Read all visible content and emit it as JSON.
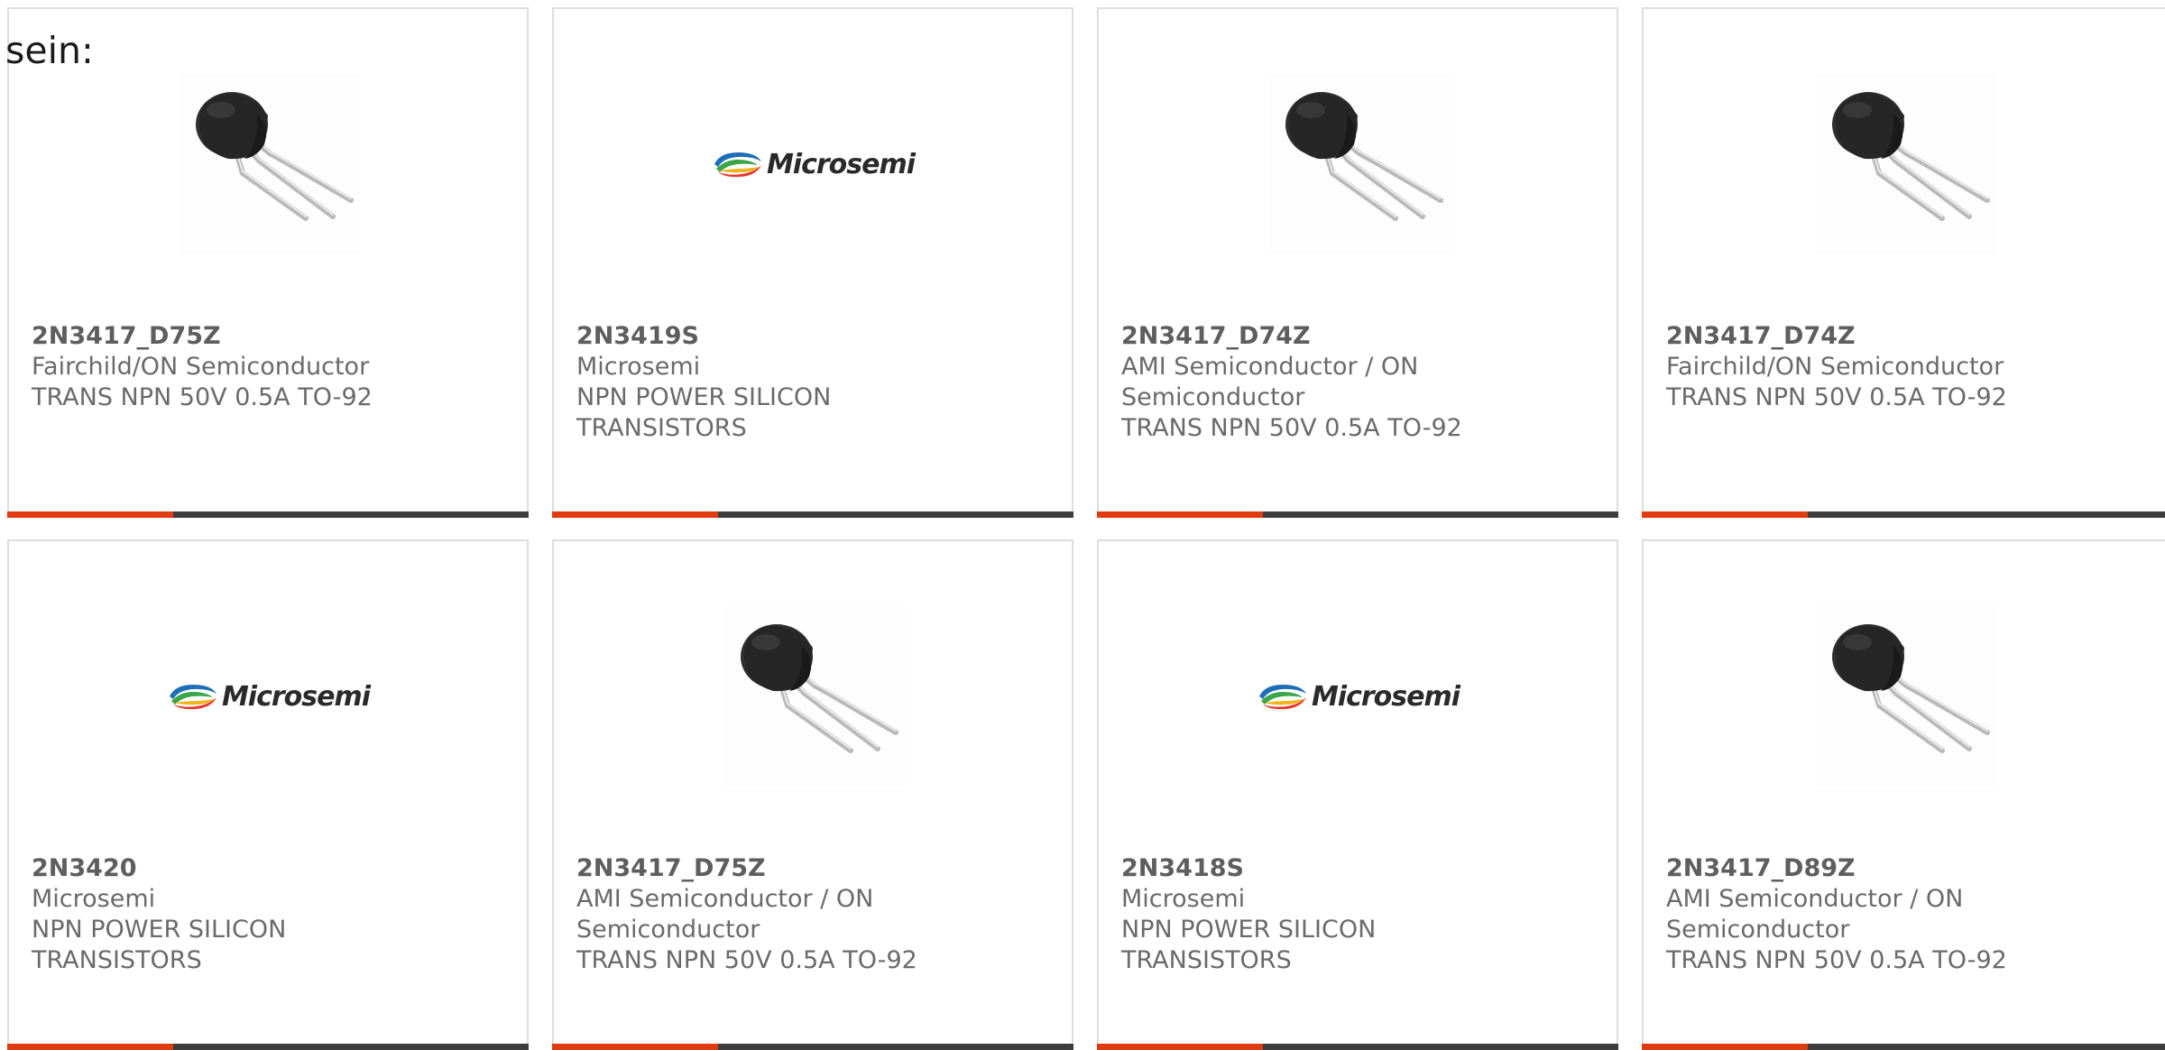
{
  "heading": "sein:",
  "colors": {
    "accent": "#e03c12",
    "bar": "#3d3d3d",
    "border": "#dedede",
    "text": "#6a6a6a"
  },
  "products": [
    {
      "part": "2N3417_D75Z",
      "manufacturer": "Fairchild/ON Semiconductor",
      "description": "TRANS NPN 50V 0.5A TO-92",
      "image": "transistor-icon"
    },
    {
      "part": "2N3419S",
      "manufacturer": "Microsemi",
      "description": "NPN POWER SILICON TRANSISTORS",
      "image": "microsemi-logo",
      "logo_text": "Microsemi"
    },
    {
      "part": "2N3417_D74Z",
      "manufacturer": "AMI Semiconductor / ON Semiconductor",
      "description": "TRANS NPN 50V 0.5A TO-92",
      "image": "transistor-icon"
    },
    {
      "part": "2N3417_D74Z",
      "manufacturer": "Fairchild/ON Semiconductor",
      "description": "TRANS NPN 50V 0.5A TO-92",
      "image": "transistor-icon"
    },
    {
      "part": "2N3420",
      "manufacturer": "Microsemi",
      "description": "NPN POWER SILICON TRANSISTORS",
      "image": "microsemi-logo",
      "logo_text": "Microsemi"
    },
    {
      "part": "2N3417_D75Z",
      "manufacturer": "AMI Semiconductor / ON Semiconductor",
      "description": "TRANS NPN 50V 0.5A TO-92",
      "image": "transistor-icon"
    },
    {
      "part": "2N3418S",
      "manufacturer": "Microsemi",
      "description": "NPN POWER SILICON TRANSISTORS",
      "image": "microsemi-logo",
      "logo_text": "Microsemi"
    },
    {
      "part": "2N3417_D89Z",
      "manufacturer": "AMI Semiconductor / ON Semiconductor",
      "description": "TRANS NPN 50V 0.5A TO-92",
      "image": "transistor-icon"
    }
  ]
}
